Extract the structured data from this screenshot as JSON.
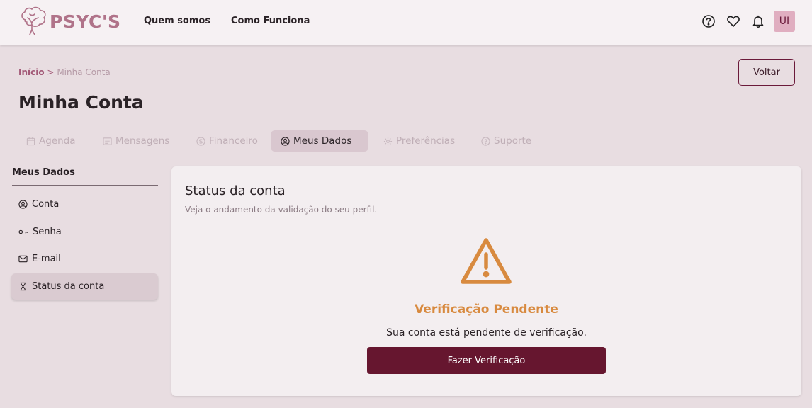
{
  "header": {
    "logo_text": "PSYC'S",
    "nav": [
      {
        "label": "Quem somos"
      },
      {
        "label": "Como Funciona"
      }
    ],
    "icons": [
      "help-icon",
      "heart-icon",
      "bell-icon"
    ],
    "avatar_initials": "UI"
  },
  "breadcrumb": {
    "home": "Início",
    "separator": ">",
    "current": "Minha Conta"
  },
  "back_button": "Voltar",
  "page_title": "Minha Conta",
  "tabs": [
    {
      "label": "Agenda",
      "icon": "calendar-icon",
      "active": false
    },
    {
      "label": "Mensagens",
      "icon": "message-icon",
      "active": false
    },
    {
      "label": "Financeiro",
      "icon": "dollar-icon",
      "active": false
    },
    {
      "label": "Meus Dados",
      "icon": "user-circle-icon",
      "active": true
    },
    {
      "label": "Preferências",
      "icon": "gear-icon",
      "active": false
    },
    {
      "label": "Suporte",
      "icon": "help-icon",
      "active": false
    }
  ],
  "sidebar": {
    "title": "Meus Dados",
    "items": [
      {
        "label": "Conta",
        "icon": "user-circle-icon",
        "active": false
      },
      {
        "label": "Senha",
        "icon": "key-icon",
        "active": false
      },
      {
        "label": "E-mail",
        "icon": "mail-icon",
        "active": false
      },
      {
        "label": "Status da conta",
        "icon": "hourglass-icon",
        "active": true
      }
    ]
  },
  "card": {
    "title": "Status da conta",
    "subtitle": "Veja o andamento da validação do seu perfil.",
    "status_title": "Verificação Pendente",
    "status_text": "Sua conta está pendente de verificação.",
    "button_label": "Fazer Verificação"
  },
  "colors": {
    "brand": "#b07389",
    "primary": "#66162f",
    "warning": "#d88a3f",
    "background": "#e8dde1"
  }
}
